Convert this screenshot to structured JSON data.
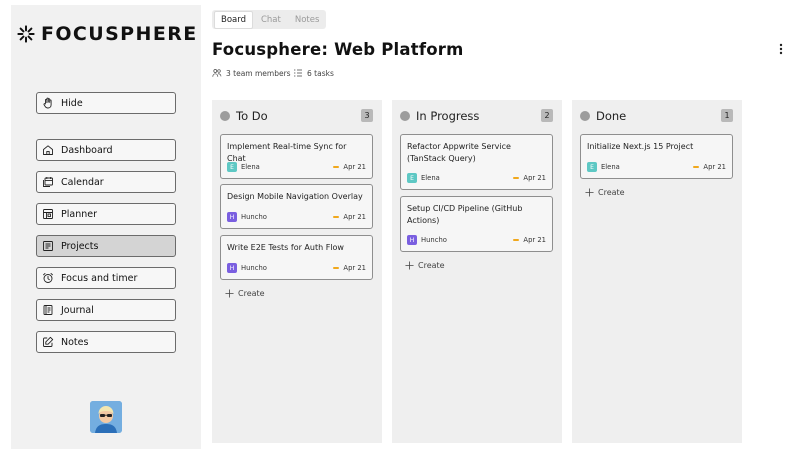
{
  "app": {
    "name": "FOCUSPHERE"
  },
  "sidebar": {
    "items": [
      {
        "label": "Hide",
        "icon": "hand-icon"
      },
      {
        "label": "Dashboard",
        "icon": "home-icon"
      },
      {
        "label": "Calendar",
        "icon": "calendar-icon"
      },
      {
        "label": "Planner",
        "icon": "planner-icon"
      },
      {
        "label": "Projects",
        "icon": "projects-icon",
        "active": true
      },
      {
        "label": "Focus and timer",
        "icon": "alarm-clock-icon"
      },
      {
        "label": "Journal",
        "icon": "journal-icon"
      },
      {
        "label": "Notes",
        "icon": "notes-icon"
      }
    ]
  },
  "tabs": [
    {
      "label": "Board",
      "active": true
    },
    {
      "label": "Chat"
    },
    {
      "label": "Notes"
    }
  ],
  "project": {
    "title": "Focusphere: Web Platform",
    "members": "3 team members",
    "tasks": "6 tasks"
  },
  "columns": [
    {
      "title": "To Do",
      "count": "3",
      "cards": [
        {
          "title": "Implement Real-time Sync for Chat",
          "assignee": "Elena",
          "initial": "E",
          "color": "#5ec8c4",
          "due": "Apr 21"
        },
        {
          "title": "Design Mobile Navigation Overlay",
          "assignee": "Huncho",
          "initial": "H",
          "color": "#7a5fe0",
          "due": "Apr 21"
        },
        {
          "title": "Write E2E Tests for Auth Flow",
          "assignee": "Huncho",
          "initial": "H",
          "color": "#7a5fe0",
          "due": "Apr 21"
        }
      ],
      "create_label": "Create"
    },
    {
      "title": "In Progress",
      "count": "2",
      "cards": [
        {
          "title": "Refactor Appwrite Service (TanStack Query)",
          "assignee": "Elena",
          "initial": "E",
          "color": "#5ec8c4",
          "due": "Apr 21"
        },
        {
          "title": "Setup CI/CD Pipeline (GitHub Actions)",
          "assignee": "Huncho",
          "initial": "H",
          "color": "#7a5fe0",
          "due": "Apr 21"
        }
      ],
      "create_label": "Create"
    },
    {
      "title": "Done",
      "count": "1",
      "cards": [
        {
          "title": "Initialize Next.js 15 Project",
          "assignee": "Elena",
          "initial": "E",
          "color": "#5ec8c4",
          "due": "Apr 21"
        }
      ],
      "create_label": "Create"
    }
  ],
  "colors": {
    "due_accent": "#f0a81d",
    "active_nav": "#d4d4d4",
    "column_bg": "#efefef"
  }
}
